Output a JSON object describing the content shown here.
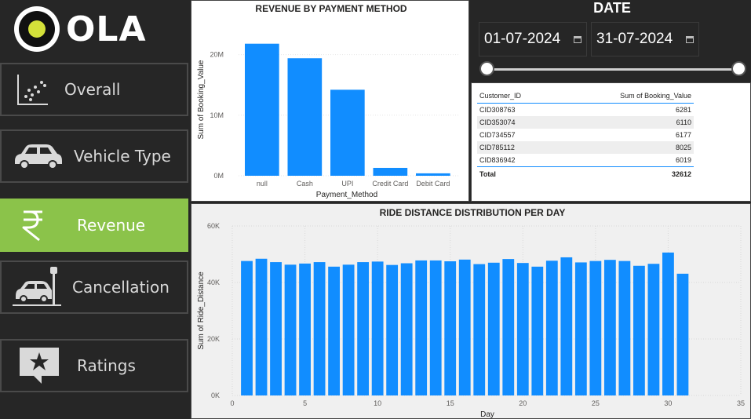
{
  "brand": {
    "logo_text": "OLA"
  },
  "nav": {
    "items": [
      {
        "label": "Overall",
        "icon": "scatter-chart-icon",
        "active": false
      },
      {
        "label": "Vehicle Type",
        "icon": "car-icon",
        "active": false
      },
      {
        "label": "Revenue",
        "icon": "rupee-icon",
        "active": true
      },
      {
        "label": "Cancellation",
        "icon": "car-crash-icon",
        "active": false
      },
      {
        "label": "Ratings",
        "icon": "star-chat-icon",
        "active": false
      }
    ],
    "active_color": "#8bc34a"
  },
  "date_filter": {
    "title": "DATE",
    "start": "01-07-2024",
    "end": "31-07-2024",
    "slider_start_fraction": 0.0,
    "slider_end_fraction": 1.0
  },
  "customer_table": {
    "columns": [
      "Customer_ID",
      "Sum of Booking_Value"
    ],
    "rows": [
      [
        "CID308763",
        "6281"
      ],
      [
        "CID353074",
        "6110"
      ],
      [
        "CID734557",
        "6177"
      ],
      [
        "CID785112",
        "8025"
      ],
      [
        "CID836942",
        "6019"
      ]
    ],
    "total_label": "Total",
    "total_value": "32612"
  },
  "chart_data": [
    {
      "type": "bar",
      "title": "REVENUE BY PAYMENT METHOD",
      "xlabel": "Payment_Method",
      "ylabel": "Sum of Booking_Value",
      "categories": [
        "null",
        "Cash",
        "UPI",
        "Credit Card",
        "Debit Card"
      ],
      "values": [
        21800000,
        19400000,
        14200000,
        1300000,
        400000
      ],
      "yticks": [
        "0M",
        "10M",
        "20M"
      ],
      "ylim": [
        0,
        25000000
      ],
      "color": "#118dff"
    },
    {
      "type": "bar",
      "title": "RIDE DISTANCE DISTRIBUTION PER DAY",
      "xlabel": "Day",
      "ylabel": "Sum of Ride_Distance",
      "x": [
        1,
        2,
        3,
        4,
        5,
        6,
        7,
        8,
        9,
        10,
        11,
        12,
        13,
        14,
        15,
        16,
        17,
        18,
        19,
        20,
        21,
        22,
        23,
        24,
        25,
        26,
        27,
        28,
        29,
        30,
        31
      ],
      "values": [
        47600,
        48400,
        47200,
        46300,
        46700,
        47200,
        45600,
        46300,
        47200,
        47400,
        46200,
        46800,
        47800,
        47800,
        47500,
        48100,
        46500,
        47000,
        48300,
        46900,
        45600,
        47700,
        48900,
        47100,
        47600,
        48000,
        47600,
        45900,
        46600,
        50600,
        43100
      ],
      "xticks": [
        "0",
        "5",
        "10",
        "15",
        "20",
        "25",
        "30",
        "35"
      ],
      "yticks": [
        "0K",
        "20K",
        "40K",
        "60K"
      ],
      "xlim": [
        0,
        35
      ],
      "ylim": [
        0,
        60000
      ],
      "grid": true,
      "color": "#118dff"
    }
  ]
}
